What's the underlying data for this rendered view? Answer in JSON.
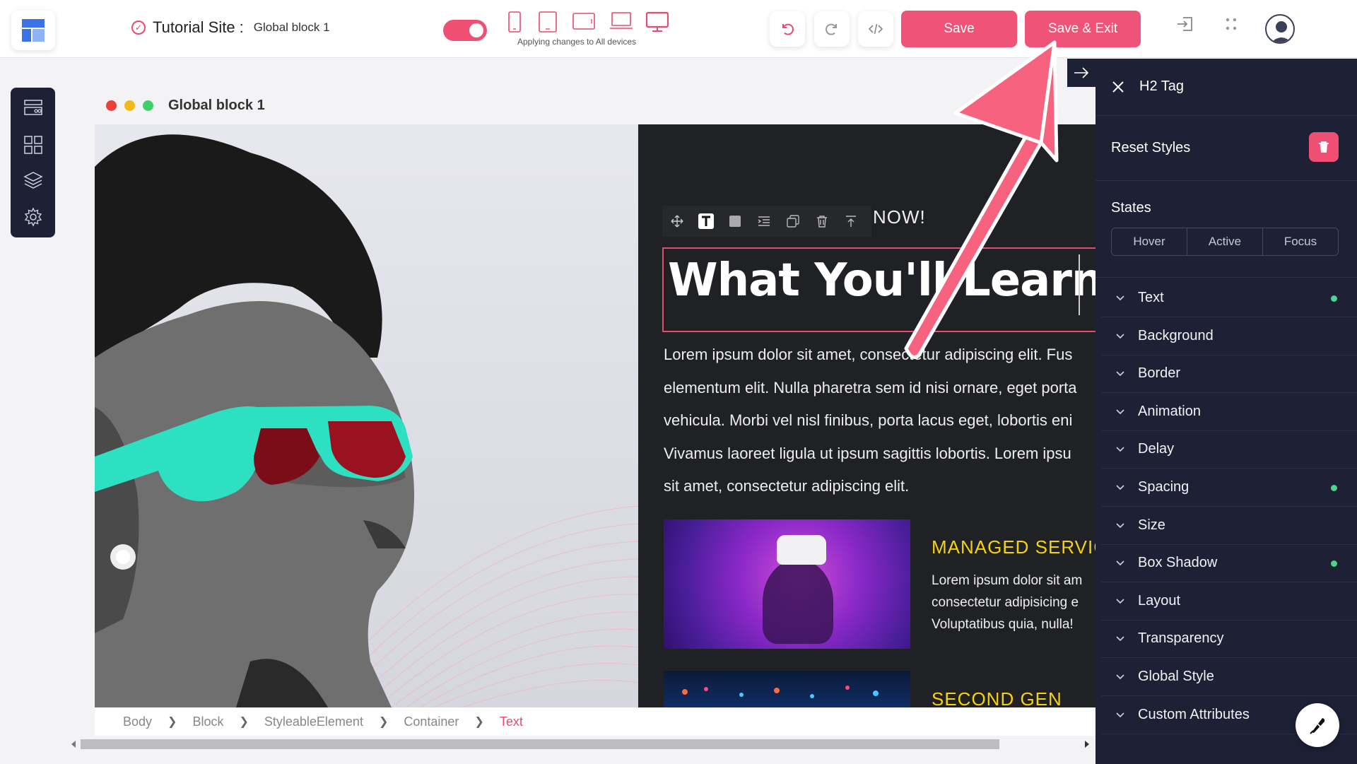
{
  "header": {
    "site_name": "Tutorial Site :",
    "block_name": "Global block 1",
    "applying_text": "Applying changes to All devices",
    "save_label": "Save",
    "save_exit_label": "Save & Exit"
  },
  "devices": [
    "mobile-portrait-icon",
    "tablet-portrait-icon",
    "tablet-landscape-icon",
    "laptop-icon",
    "desktop-icon"
  ],
  "canvas": {
    "title": "Global block 1",
    "partial_heading": "NOW!",
    "heading": "What You'll Learn!",
    "paragraph_lines": [
      "Lorem ipsum dolor sit amet, consectetur adipiscing elit. Fus",
      "elementum elit. Nulla pharetra sem id nisi ornare, eget porta",
      "vehicula. Morbi vel nisl finibus, porta lacus eget, lobortis eni",
      "Vivamus laoreet ligula ut ipsum sagittis lobortis. Lorem ipsu",
      "sit amet, consectetur adipiscing elit."
    ],
    "card1_title": "MANAGED SERVIC",
    "card1_lines": [
      "Lorem ipsum dolor sit am",
      "consectetur adipisicing e",
      "Voluptatibus quia, nulla!"
    ],
    "card2_title": "SECOND GEN"
  },
  "breadcrumbs": [
    "Body",
    "Block",
    "StyleableElement",
    "Container",
    "Text"
  ],
  "panel": {
    "title": "H2 Tag",
    "reset_label": "Reset Styles",
    "states_label": "States",
    "states": [
      "Hover",
      "Active",
      "Focus"
    ],
    "sections": [
      {
        "label": "Text",
        "modified": true
      },
      {
        "label": "Background",
        "modified": false
      },
      {
        "label": "Border",
        "modified": false
      },
      {
        "label": "Animation",
        "modified": false
      },
      {
        "label": "Delay",
        "modified": false
      },
      {
        "label": "Spacing",
        "modified": true
      },
      {
        "label": "Size",
        "modified": false
      },
      {
        "label": "Box Shadow",
        "modified": true
      },
      {
        "label": "Layout",
        "modified": false
      },
      {
        "label": "Transparency",
        "modified": false
      },
      {
        "label": "Global Style",
        "modified": false
      },
      {
        "label": "Custom Attributes",
        "modified": false
      }
    ]
  },
  "colors": {
    "accent": "#ef5478",
    "panel_bg": "#1e2036",
    "highlight_yellow": "#f5d20d",
    "modified_dot": "#47d68b",
    "annotation_arrow": "#f7627f"
  }
}
